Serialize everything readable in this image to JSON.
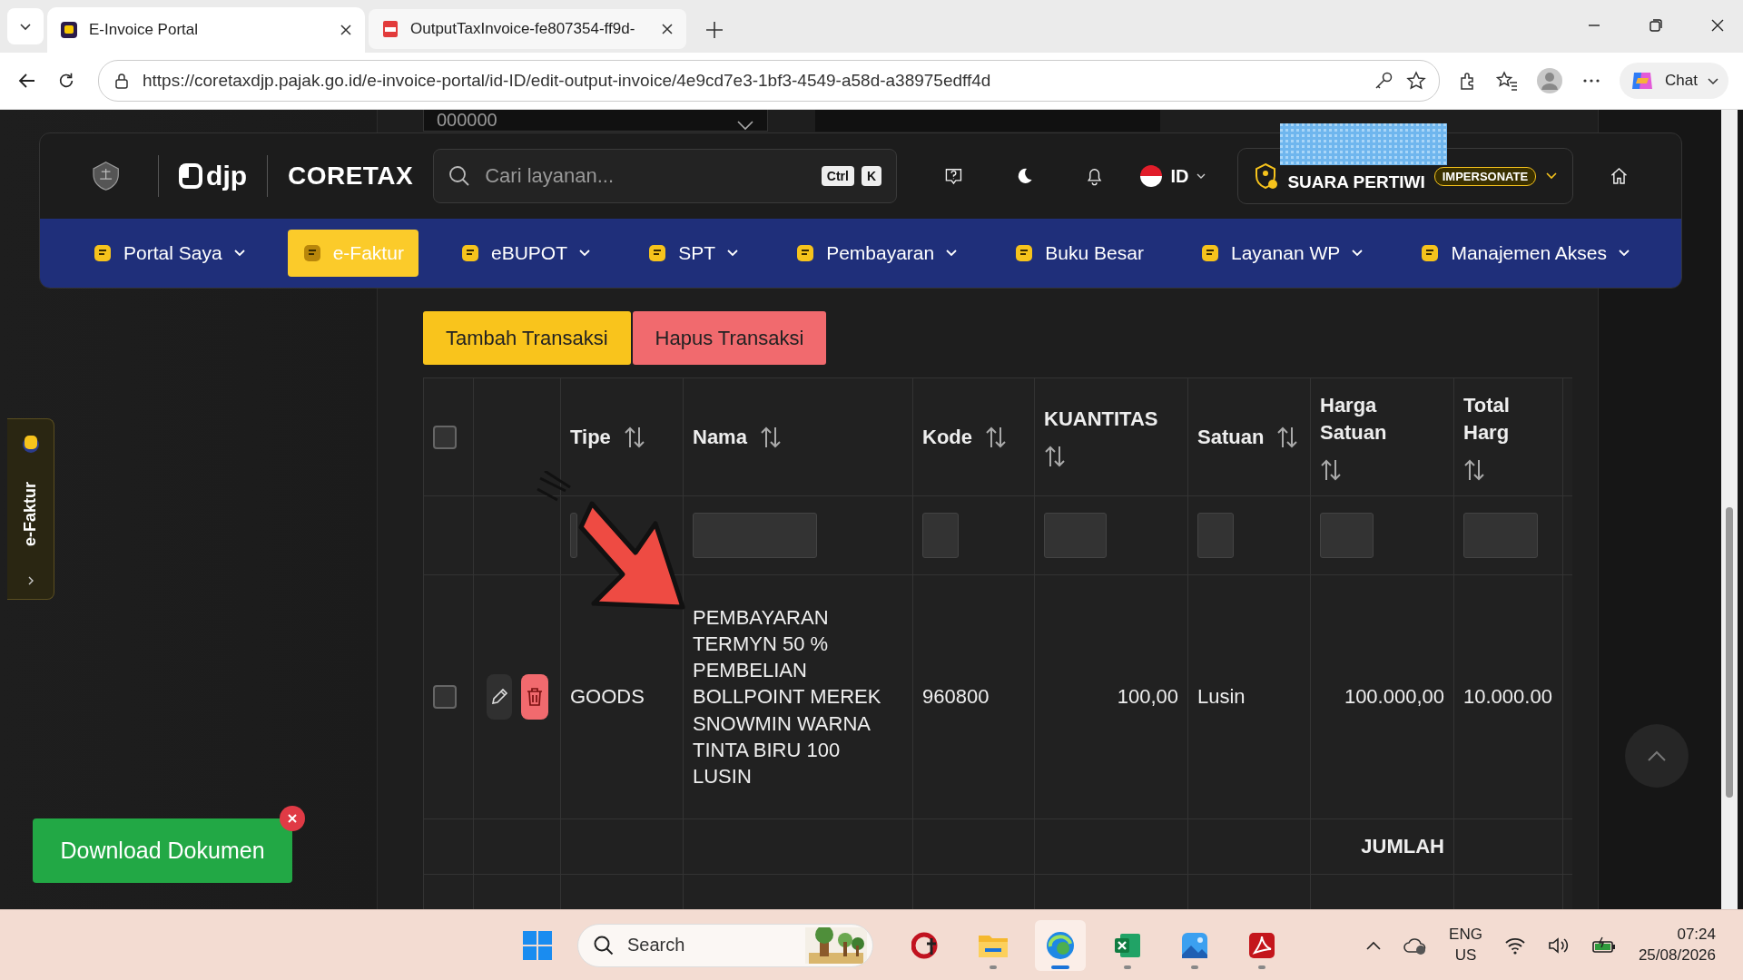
{
  "browser": {
    "tabs": [
      {
        "title": "E-Invoice Portal",
        "kind": "site",
        "selected": true
      },
      {
        "title": "OutputTaxInvoice-fe807354-ff9d-",
        "kind": "pdf",
        "selected": false
      }
    ],
    "url": "https://coretaxdjp.pajak.go.id/e-invoice-portal/id-ID/edit-output-invoice/4e9cd7e3-1bf3-4549-a58d-a38975edff4d",
    "chat": "Chat"
  },
  "page": {
    "top_field": "000000",
    "header": {
      "brand": "djp",
      "product": "CORETAX",
      "search_placeholder": "Cari layanan...",
      "shortcut": [
        "Ctrl",
        "K"
      ],
      "language": "ID",
      "user": "SUARA PERTIWI",
      "badge": "IMPERSONATE"
    },
    "nav": [
      {
        "label": "Portal Saya",
        "selected": false,
        "menu": true
      },
      {
        "label": "e-Faktur",
        "selected": true,
        "menu": false
      },
      {
        "label": "eBUPOT",
        "selected": false,
        "menu": true
      },
      {
        "label": "SPT",
        "selected": false,
        "menu": true
      },
      {
        "label": "Pembayaran",
        "selected": false,
        "menu": true
      },
      {
        "label": "Buku Besar",
        "selected": false,
        "menu": false
      },
      {
        "label": "Layanan WP",
        "selected": false,
        "menu": true
      },
      {
        "label": "Manajemen Akses",
        "selected": false,
        "menu": true
      }
    ],
    "actions": [
      {
        "label": "Tambah Transaksi",
        "kind": "add"
      },
      {
        "label": "Hapus Transaksi",
        "kind": "delete"
      }
    ],
    "table": {
      "select_all_checked": false,
      "columns": [
        {
          "label": "Tipe"
        },
        {
          "label": "Nama"
        },
        {
          "label": "Kode"
        },
        {
          "label": "KUANTITAS"
        },
        {
          "label": "Satuan"
        },
        {
          "label": "Harga Satuan"
        },
        {
          "label": "Total Harg"
        }
      ],
      "rows": [
        {
          "checked": false,
          "cells": [
            "GOODS",
            "PEMBAYARAN TERMYN 50 % PEMBELIAN BOLLPOINT MEREK SNOWMIN WARNA TINTA BIRU 100 LUSIN",
            "960800",
            "100,00",
            "Lusin",
            "100.000,00",
            "10.000.00"
          ]
        }
      ],
      "total_label": "JUMLAH"
    },
    "side_tab": "e-Faktur",
    "download_button": "Download Dokumen"
  },
  "taskbar": {
    "search_placeholder": "Search",
    "apps": [
      {
        "kind": "ct",
        "running": false,
        "selected": false
      },
      {
        "kind": "folder",
        "running": true,
        "selected": false
      },
      {
        "kind": "edge",
        "running": true,
        "selected": true
      },
      {
        "kind": "excel",
        "running": true,
        "selected": false
      },
      {
        "kind": "photos",
        "running": true,
        "selected": false
      },
      {
        "kind": "acrobat",
        "running": true,
        "selected": false
      }
    ],
    "language": [
      "ENG",
      "US"
    ],
    "time": "07:24",
    "date": "25/08/2026"
  }
}
